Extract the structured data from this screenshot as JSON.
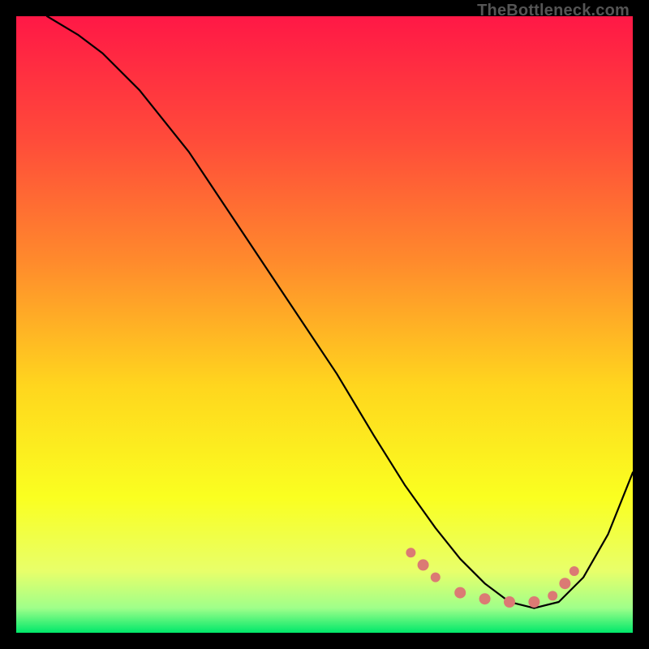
{
  "watermark": "TheBottleneck.com",
  "chart_data": {
    "type": "line",
    "title": "",
    "xlabel": "",
    "ylabel": "",
    "xlim": [
      0,
      100
    ],
    "ylim": [
      0,
      100
    ],
    "background_gradient_stops": [
      {
        "offset": 0.0,
        "color": "#ff1846"
      },
      {
        "offset": 0.2,
        "color": "#ff4b3a"
      },
      {
        "offset": 0.4,
        "color": "#ff8b2c"
      },
      {
        "offset": 0.6,
        "color": "#ffd61e"
      },
      {
        "offset": 0.78,
        "color": "#faff20"
      },
      {
        "offset": 0.9,
        "color": "#e8ff6a"
      },
      {
        "offset": 0.96,
        "color": "#9fff8a"
      },
      {
        "offset": 1.0,
        "color": "#00e86a"
      }
    ],
    "series": [
      {
        "name": "bottleneck_curve",
        "x": [
          5,
          10,
          14,
          20,
          28,
          36,
          44,
          52,
          58,
          63,
          68,
          72,
          76,
          80,
          84,
          88,
          92,
          96,
          100
        ],
        "y": [
          100,
          97,
          94,
          88,
          78,
          66,
          54,
          42,
          32,
          24,
          17,
          12,
          8,
          5,
          4,
          5,
          9,
          16,
          26
        ]
      }
    ],
    "markers": {
      "name": "highlighted_points",
      "color": "#db7a74",
      "points": [
        {
          "x": 64,
          "y": 13,
          "r": 6
        },
        {
          "x": 66,
          "y": 11,
          "r": 7
        },
        {
          "x": 68,
          "y": 9,
          "r": 6
        },
        {
          "x": 72,
          "y": 6.5,
          "r": 7
        },
        {
          "x": 76,
          "y": 5.5,
          "r": 7
        },
        {
          "x": 80,
          "y": 5,
          "r": 7
        },
        {
          "x": 84,
          "y": 5,
          "r": 7
        },
        {
          "x": 87,
          "y": 6,
          "r": 6
        },
        {
          "x": 89,
          "y": 8,
          "r": 7
        },
        {
          "x": 90.5,
          "y": 10,
          "r": 6
        }
      ]
    }
  }
}
